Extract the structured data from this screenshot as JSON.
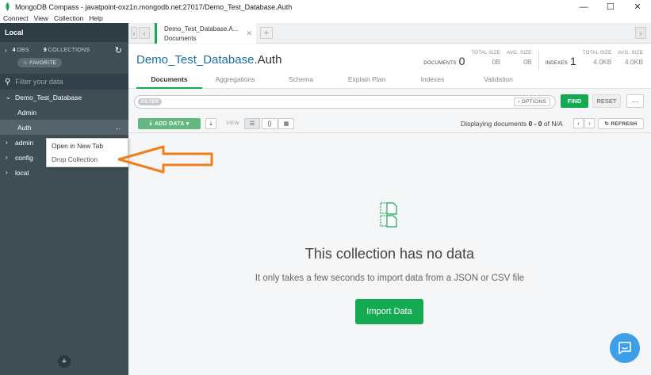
{
  "window": {
    "title": "MongoDB Compass - javatpoint-oxz1n.mongodb.net:27017/Demo_Test_Database.Auth",
    "minimize": "—",
    "maximize": "☐",
    "close": "✕"
  },
  "menu": [
    "Connect",
    "View",
    "Collection",
    "Help"
  ],
  "sidebar": {
    "header": "Local",
    "dbs_count": "4",
    "dbs_label": "DBS",
    "collections_count": "9",
    "collections_label": "COLLECTIONS",
    "favorite_label": "☆ FAVORITE",
    "filter_placeholder": "Filter your data",
    "databases": [
      {
        "name": "Demo_Test_Database",
        "expanded": true,
        "collections": [
          "Admin",
          "Auth"
        ]
      },
      {
        "name": "admin",
        "expanded": false
      },
      {
        "name": "config",
        "expanded": false
      },
      {
        "name": "local",
        "expanded": false
      }
    ],
    "active_collection_dots": "...",
    "add_label": "+"
  },
  "context_menu": {
    "items": [
      "Open in New Tab",
      "Drop Collection"
    ]
  },
  "tab": {
    "title": "Demo_Test_Database.A...",
    "subtitle": "Documents",
    "close": "✕",
    "add": "+"
  },
  "header": {
    "db_name": "Demo_Test_Database",
    "collection_name": ".Auth",
    "documents_label": "DOCUMENTS",
    "documents_count": "0",
    "total_size_label": "TOTAL SIZE",
    "total_size_value": "0B",
    "avg_size_label": "AVG. SIZE",
    "avg_size_value": "0B",
    "indexes_label": "INDEXES",
    "indexes_count": "1",
    "idx_total_size_label": "TOTAL SIZE",
    "idx_total_size_value": "4.0KB",
    "idx_avg_size_label": "AVG. SIZE",
    "idx_avg_size_value": "4.0KB"
  },
  "subtabs": [
    "Documents",
    "Aggregations",
    "Schema",
    "Explain Plan",
    "Indexes",
    "Validation"
  ],
  "query": {
    "filter_label": "FILTER",
    "options_label": "› OPTIONS",
    "find_label": "FIND",
    "reset_label": "RESET",
    "more_label": "···"
  },
  "toolbar": {
    "add_data_label": "ADD DATA ▾",
    "view_label": "VIEW",
    "displaying_prefix": "Displaying documents ",
    "displaying_range": "0 - 0",
    "displaying_suffix": " of N/A",
    "prev": "‹",
    "next": "›",
    "refresh_label": "↻ REFRESH"
  },
  "empty_state": {
    "title": "This collection has no data",
    "subtitle": "It only takes a few seconds to import data from a JSON or CSV file",
    "button": "Import Data"
  },
  "colors": {
    "brand_green": "#13aa52",
    "sidebar_bg": "#3f4d55",
    "annotation_arrow": "#f07f1a",
    "chat_blue": "#3d9fe8"
  }
}
